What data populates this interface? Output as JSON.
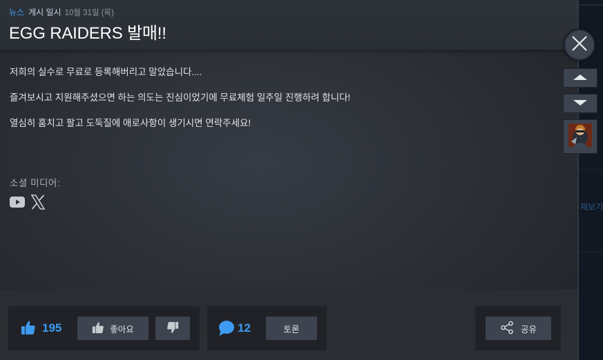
{
  "header": {
    "category": "뉴스",
    "posted_label": "게시 일시",
    "date": "10월 31일 (목)",
    "title": "EGG RAIDERS 발매!!"
  },
  "body": {
    "paragraphs": [
      "저희의 실수로 무료로 등록해버리고 말았습니다....",
      "즐겨보시고 지원해주셨으면 하는 의도는 진심이었기에 무료체험 일주일 진행하려 합니다!",
      "열심히 훔치고 팔고 도둑질에 애로사항이 생기시면 연락주세요!"
    ],
    "social_label": "소셜 미디어:",
    "social_icons": [
      "youtube-icon",
      "x-icon"
    ]
  },
  "footer": {
    "likes_count": "195",
    "like_button_label": "좋아요",
    "comment_count": "12",
    "discuss_button_label": "토론",
    "share_button_label": "공유"
  },
  "sidebar": {
    "faded_text": "재보기"
  },
  "colors": {
    "accent": "#3e9bf2",
    "button_bg": "#3d4450",
    "panel_bg": "#202227"
  }
}
